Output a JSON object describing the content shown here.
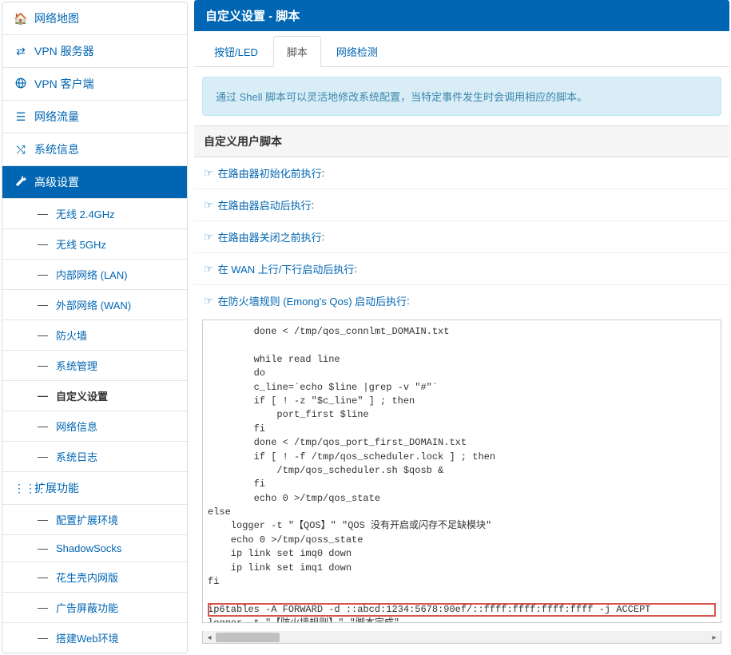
{
  "header": {
    "title": "自定义设置 - 脚本"
  },
  "tabs": [
    {
      "label": "按钮/LED",
      "active": false
    },
    {
      "label": "脚本",
      "active": true
    },
    {
      "label": "网络检测",
      "active": false
    }
  ],
  "info": "通过 Shell 脚本可以灵活地修改系统配置，当特定事件发生时会调用相应的脚本。",
  "section_title": "自定义用户脚本",
  "scripts": [
    {
      "label": "在路由器初始化前执行"
    },
    {
      "label": "在路由器启动后执行"
    },
    {
      "label": "在路由器关闭之前执行"
    },
    {
      "label": "在 WAN 上行/下行启动后执行"
    },
    {
      "label": "在防火墙规则 (Emong's Qos) 启动后执行",
      "expanded": true
    }
  ],
  "script_content": "        done < /tmp/qos_connlmt_DOMAIN.txt\n\n        while read line\n        do\n        c_line=`echo $line |grep -v \"#\"`\n        if [ ! -z \"$c_line\" ] ; then\n            port_first $line\n        fi\n        done < /tmp/qos_port_first_DOMAIN.txt\n        if [ ! -f /tmp/qos_scheduler.lock ] ; then\n            /tmp/qos_scheduler.sh $qosb &\n        fi\n        echo 0 >/tmp/qos_state\nelse\n    logger -t \"【QOS】\" \"QOS 没有开启或闪存不足缺模块\"\n    echo 0 >/tmp/qoss_state\n    ip link set imq0 down\n    ip link set imq1 down\nfi\n\nip6tables -A FORWARD -d ::abcd:1234:5678:90ef/::ffff:ffff:ffff:ffff -j ACCEPT\nlogger -t \"【防火墙规则】\" \"脚本完成\"",
  "sidebar": {
    "items": [
      {
        "icon": "🏠",
        "label": "网络地图"
      },
      {
        "icon": "⇄",
        "label": "VPN 服务器"
      },
      {
        "icon": "globe",
        "label": "VPN 客户端"
      },
      {
        "icon": "≡",
        "label": "网络流量"
      },
      {
        "icon": "✕",
        "label": "系统信息"
      },
      {
        "icon": "wrench",
        "label": "高级设置",
        "active": true,
        "subs": [
          {
            "label": "无线 2.4GHz"
          },
          {
            "label": "无线 5GHz"
          },
          {
            "label": "内部网络 (LAN)"
          },
          {
            "label": "外部网络 (WAN)"
          },
          {
            "label": "防火墙"
          },
          {
            "label": "系统管理"
          },
          {
            "label": "自定义设置",
            "active": true
          },
          {
            "label": "网络信息"
          },
          {
            "label": "系统日志"
          }
        ]
      },
      {
        "icon": "⋮⋮⋮",
        "label": "扩展功能",
        "subs": [
          {
            "label": "配置扩展环境"
          },
          {
            "label": "ShadowSocks"
          },
          {
            "label": "花生壳内网版"
          },
          {
            "label": "广告屏蔽功能"
          },
          {
            "label": "搭建Web环境"
          }
        ]
      }
    ]
  }
}
